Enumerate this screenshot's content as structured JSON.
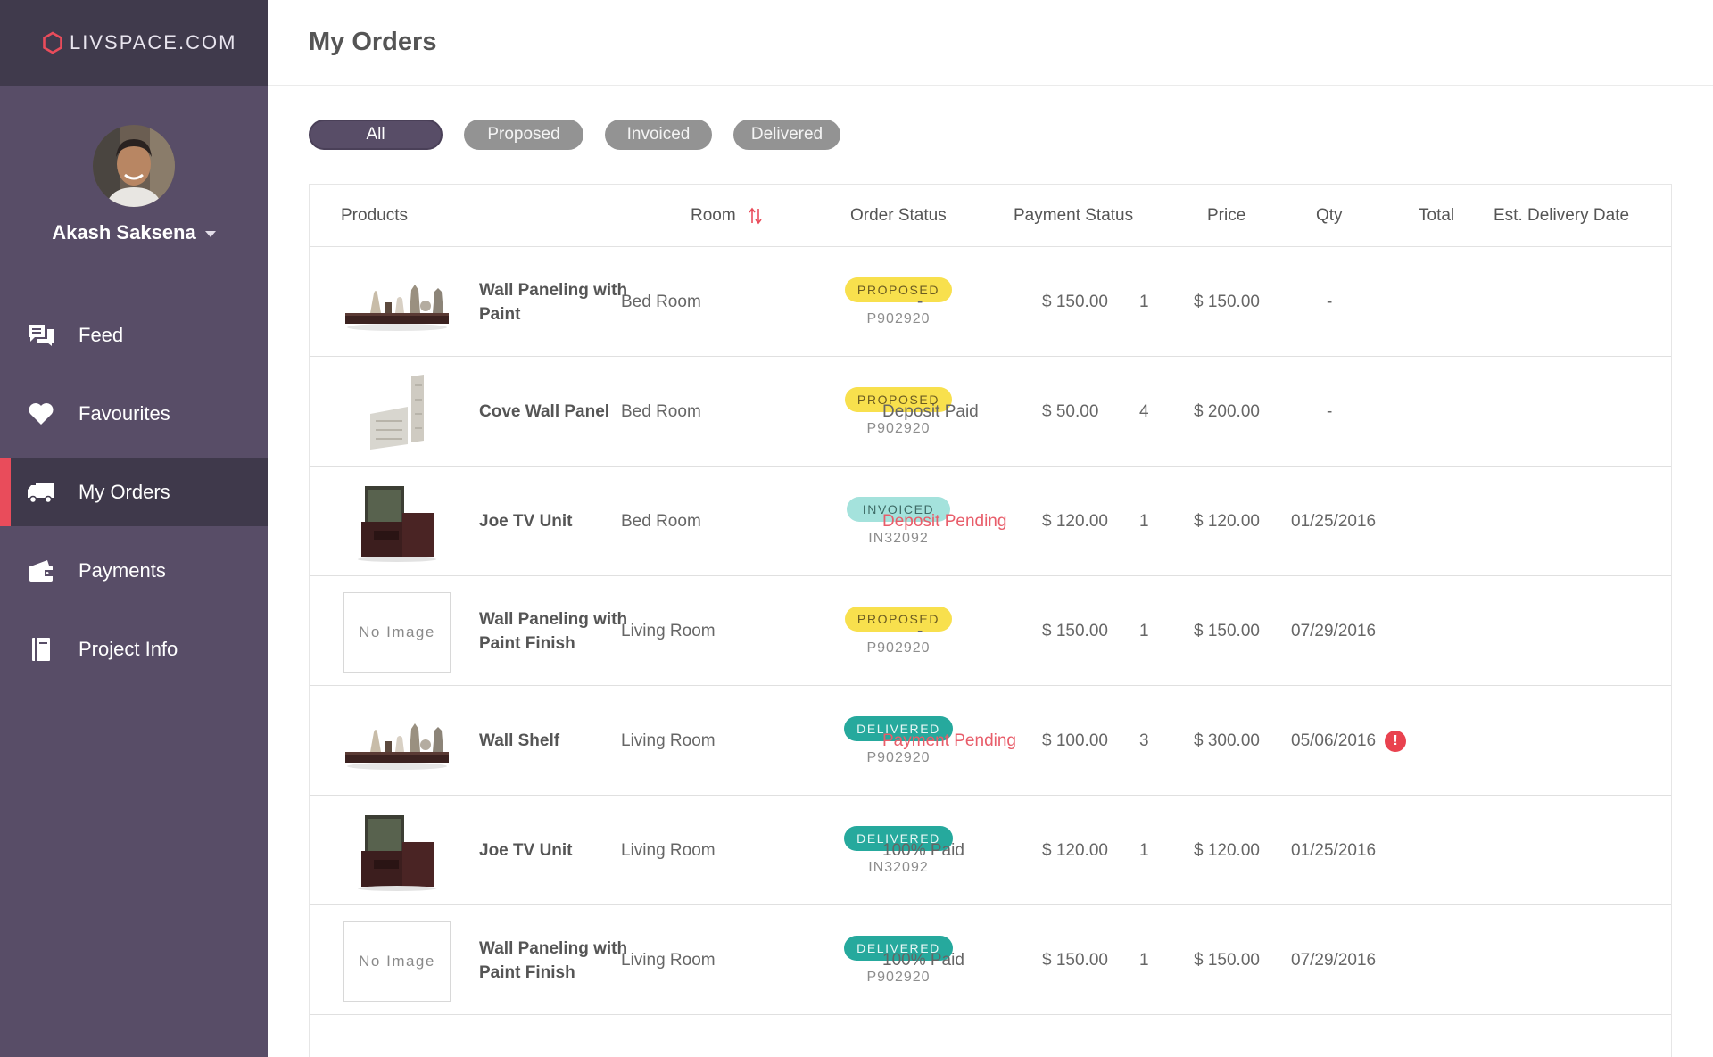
{
  "brand": {
    "name": "LIVSPACE.COM"
  },
  "user": {
    "name": "Akash Saksena"
  },
  "nav": [
    {
      "label": "Feed",
      "icon": "chat-icon",
      "active": false
    },
    {
      "label": "Favourites",
      "icon": "heart-icon",
      "active": false
    },
    {
      "label": "My Orders",
      "icon": "truck-icon",
      "active": true
    },
    {
      "label": "Payments",
      "icon": "wallet-icon",
      "active": false
    },
    {
      "label": "Project Info",
      "icon": "book-icon",
      "active": false
    }
  ],
  "page": {
    "title": "My Orders"
  },
  "filters": [
    {
      "label": "All",
      "active": true
    },
    {
      "label": "Proposed",
      "active": false
    },
    {
      "label": "Invoiced",
      "active": false
    },
    {
      "label": "Delivered",
      "active": false
    }
  ],
  "columns": {
    "products": "Products",
    "room": "Room",
    "order_status": "Order Status",
    "payment_status": "Payment Status",
    "price": "Price",
    "qty": "Qty",
    "total": "Total",
    "delivery": "Est. Delivery Date"
  },
  "no_image_text": "No Image",
  "orders": [
    {
      "product": "Wall Paneling with Paint",
      "image": "shelf",
      "room": "Bed Room",
      "status": "PROPOSED",
      "status_type": "proposed",
      "order_id": "P902920",
      "payment": "-",
      "payment_type": "dash",
      "price": "$ 150.00",
      "qty": "1",
      "total": "$ 150.00",
      "delivery": "-",
      "alert": false
    },
    {
      "product": "Cove Wall Panel",
      "image": "panel",
      "room": "Bed Room",
      "status": "PROPOSED",
      "status_type": "proposed",
      "order_id": "P902920",
      "payment": "Deposit Paid",
      "payment_type": "normal",
      "price": "$ 50.00",
      "qty": "4",
      "total": "$ 200.00",
      "delivery": "-",
      "alert": false
    },
    {
      "product": "Joe TV Unit",
      "image": "tv",
      "room": "Bed Room",
      "status": "INVOICED",
      "status_type": "invoiced",
      "order_id": "IN32092",
      "payment": "Deposit Pending",
      "payment_type": "pending",
      "price": "$ 120.00",
      "qty": "1",
      "total": "$ 120.00",
      "delivery": "01/25/2016",
      "alert": false
    },
    {
      "product": "Wall Paneling with Paint Finish",
      "image": "none",
      "room": "Living Room",
      "status": "PROPOSED",
      "status_type": "proposed",
      "order_id": "P902920",
      "payment": "-",
      "payment_type": "dash",
      "price": "$ 150.00",
      "qty": "1",
      "total": "$ 150.00",
      "delivery": "07/29/2016",
      "alert": false
    },
    {
      "product": "Wall Shelf",
      "image": "shelf",
      "room": "Living Room",
      "status": "DELIVERED",
      "status_type": "delivered",
      "order_id": "P902920",
      "payment": "Payment Pending",
      "payment_type": "pending",
      "price": "$ 100.00",
      "qty": "3",
      "total": "$ 300.00",
      "delivery": "05/06/2016",
      "alert": true,
      "alert_symbol": "!"
    },
    {
      "product": "Joe TV Unit",
      "image": "tv",
      "room": "Living Room",
      "status": "DELIVERED",
      "status_type": "delivered",
      "order_id": "IN32092",
      "payment": "100% Paid",
      "payment_type": "normal",
      "price": "$ 120.00",
      "qty": "1",
      "total": "$ 120.00",
      "delivery": "01/25/2016",
      "alert": false
    },
    {
      "product": "Wall Paneling with Paint Finish",
      "image": "none",
      "room": "Living Room",
      "status": "DELIVERED",
      "status_type": "delivered",
      "order_id": "P902920",
      "payment": "100% Paid",
      "payment_type": "normal",
      "price": "$ 150.00",
      "qty": "1",
      "total": "$ 150.00",
      "delivery": "07/29/2016",
      "alert": false
    }
  ],
  "colors": {
    "sidebar": "#584d67",
    "sidebar_dark": "#403a4c",
    "accent": "#e94c5b",
    "proposed": "#f8e04d",
    "invoiced": "#a4e2dc",
    "delivered": "#26a99d",
    "pending_text": "#e85d6a"
  }
}
